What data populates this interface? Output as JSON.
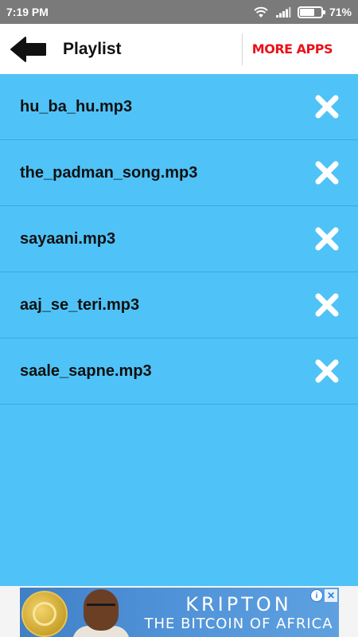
{
  "status_bar": {
    "time": "7:19 PM",
    "battery": "71%",
    "battery_level": 0.71
  },
  "app_bar": {
    "back_icon": "arrow-left-icon",
    "title": "Playlist",
    "more_apps": "MORE APPS"
  },
  "playlist": {
    "items": [
      {
        "name": "hu_ba_hu.mp3"
      },
      {
        "name": "the_padman_song.mp3"
      },
      {
        "name": "sayaani.mp3"
      },
      {
        "name": "aaj_se_teri.mp3"
      },
      {
        "name": "saale_sapne.mp3"
      }
    ],
    "remove_icon": "close-icon"
  },
  "ad": {
    "headline": "KRIPTON",
    "subline": "THE BITCOIN OF AFRICA"
  },
  "colors": {
    "list_background": "#4fc3f7",
    "status_bar": "#7a7a7a",
    "more_apps": "#e8121a"
  }
}
